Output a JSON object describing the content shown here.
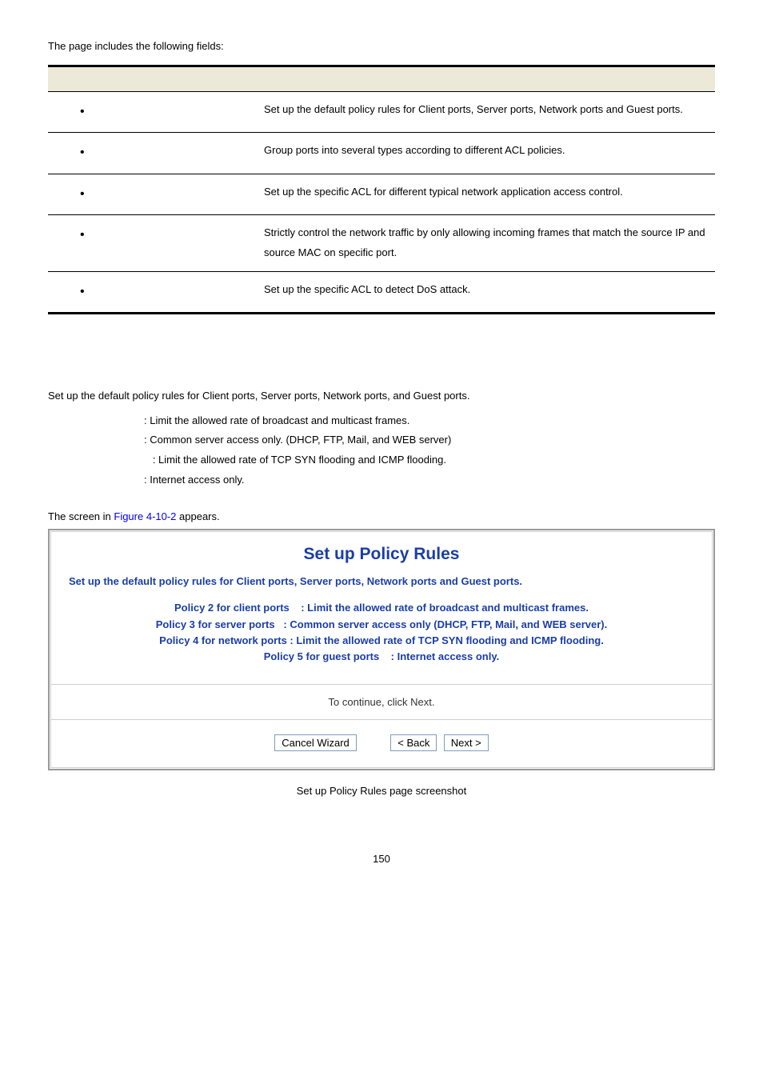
{
  "intro": "The page includes the following fields:",
  "table_rows": [
    {
      "desc": "Set up the default policy rules for Client ports, Server ports, Network ports and Guest ports."
    },
    {
      "desc": "Group ports into several types according to different ACL policies."
    },
    {
      "desc": "Set up the specific ACL for different typical network application access control."
    },
    {
      "desc": "Strictly control the network traffic by only allowing incoming frames that match the source IP and source MAC on specific port."
    },
    {
      "desc": "Set up the specific ACL to detect DoS attack."
    }
  ],
  "policy": {
    "main": "Set up the default policy rules for Client ports, Server ports, Network ports, and Guest ports.",
    "p2": ": Limit the allowed rate of broadcast and multicast frames.",
    "p3": " : Common server access only. (DHCP, FTP, Mail, and WEB server)",
    "p4": "   : Limit the allowed rate of TCP SYN flooding and ICMP flooding.",
    "p5": ": Internet access only."
  },
  "screen_line_pre": "The screen in ",
  "screen_line_link": "Figure 4-10-2",
  "screen_line_post": " appears.",
  "wizard": {
    "title": "Set up Policy Rules",
    "subtitle": "Set up the default policy rules for Client ports, Server ports, Network ports and Guest ports.",
    "p2": "Policy 2 for client ports    : Limit the allowed rate of broadcast and multicast frames.",
    "p3": "Policy 3 for server ports   : Common server access only (DHCP, FTP, Mail, and WEB server).",
    "p4": "Policy 4 for network ports : Limit the allowed rate of TCP SYN flooding and ICMP flooding.",
    "p5": "Policy 5 for guest ports    : Internet access only.",
    "continue": "To continue, click Next.",
    "cancel": "Cancel Wizard",
    "back": "< Back",
    "next": "Next >"
  },
  "caption": " Set up Policy Rules page screenshot",
  "page_number": "150"
}
